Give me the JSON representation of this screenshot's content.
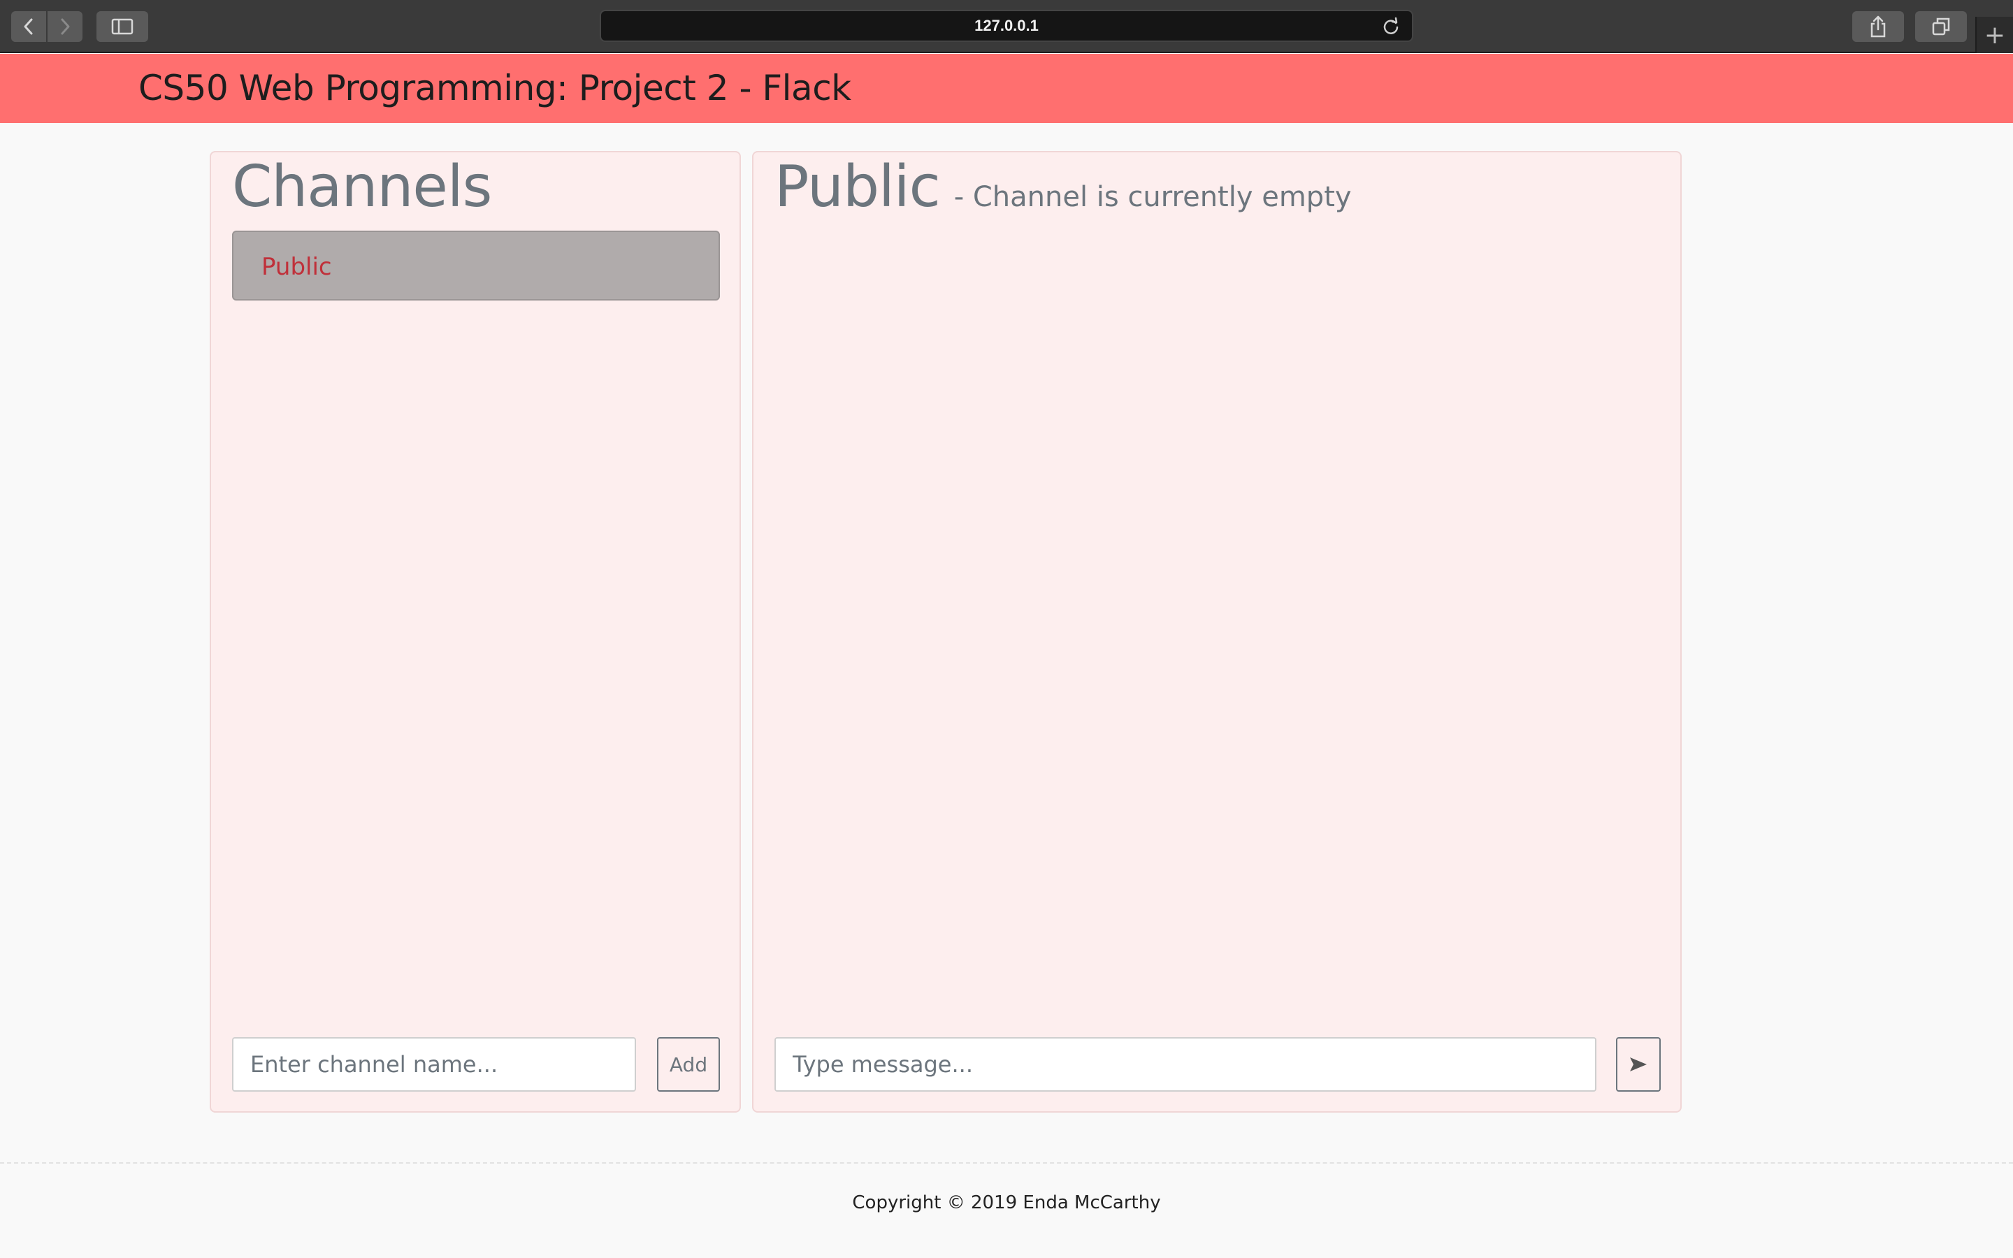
{
  "browser": {
    "address": "127.0.0.1",
    "new_tab_glyph": "+"
  },
  "header": {
    "title": "CS50 Web Programming: Project 2 - Flack",
    "background_color": "#ff6f6f"
  },
  "channels": {
    "title": "Channels",
    "items": [
      {
        "label": "Public",
        "selected": true
      }
    ],
    "input_placeholder": "Enter channel name...",
    "add_label": "Add"
  },
  "chat": {
    "title": "Public",
    "subtitle": "- Channel is currently empty",
    "message_placeholder": "Type message...",
    "send_icon": "send-arrow-icon"
  },
  "footer": {
    "text": "Copyright © 2019 Enda McCarthy"
  }
}
